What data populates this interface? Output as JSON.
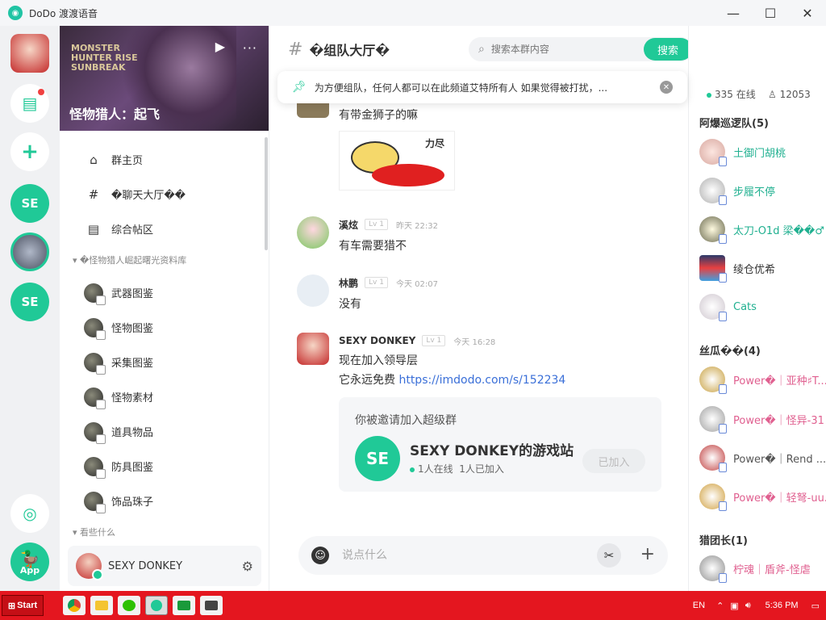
{
  "window": {
    "title": "DoDo 渡渡语音"
  },
  "rail": {
    "se1": "SE",
    "se2": "SE",
    "app_label": "App"
  },
  "guild": {
    "name": "怪物猎人：起飞",
    "banner_text": "MONSTER HUNTER RISE SUNBREAK"
  },
  "channels": [
    {
      "label": "群主页",
      "icon": "home-icon"
    },
    {
      "label": "�聊天大厅��",
      "icon": "hash-icon"
    },
    {
      "label": "综合帖区",
      "icon": "post-icon"
    }
  ],
  "category1": "�怪物猎人崛起曙光资料库",
  "subchannels": [
    {
      "label": "武器图鉴"
    },
    {
      "label": "怪物图鉴"
    },
    {
      "label": "采集图鉴"
    },
    {
      "label": "怪物素材"
    },
    {
      "label": "道具物品"
    },
    {
      "label": "防具图鉴"
    },
    {
      "label": "饰品珠子"
    }
  ],
  "category2": "看些什么",
  "user": {
    "name": "SEXY DONKEY"
  },
  "header": {
    "channel": "�组队大厅�",
    "search_placeholder": "搜索本群内容",
    "search_button": "搜索"
  },
  "notice": {
    "text": "为方便组队，任何人都可以在此频道艾特所有人 如果觉得被打扰，..."
  },
  "messages": [
    {
      "text": "有带金狮子的嘛",
      "sticker": "力尽"
    },
    {
      "name": "溪炫",
      "level": "Lv 1",
      "time": "昨天 22:32",
      "text": "有车需要猎不"
    },
    {
      "name": "林鹏",
      "level": "Lv 1",
      "time": "今天 02:07",
      "text": "没有"
    },
    {
      "name": "SEXY DONKEY",
      "level": "Lv 1",
      "time": "今天 16:28",
      "text1": "现在加入领导层",
      "text2": "它永远免费 ",
      "link": "https://imdodo.com/s/152234"
    }
  ],
  "invite": {
    "title": "你被邀请加入超级群",
    "avatar": "SE",
    "group": "SEXY DONKEY的游戏站",
    "online": "1人在线",
    "joined_count": "1人已加入",
    "button": "已加入"
  },
  "input": {
    "placeholder": "说点什么"
  },
  "members_panel": {
    "online": "335 在线",
    "total": "12053",
    "groups": [
      {
        "name": "阿爆巡逻队(5)"
      },
      {
        "name": "丝瓜��(4)"
      },
      {
        "name": "猎团长(1)"
      }
    ],
    "members": [
      {
        "name": "土御门胡桃",
        "color": "#20b090"
      },
      {
        "name": "步履不停",
        "color": "#20b090"
      },
      {
        "name": "太刀-O1d 梁��♂",
        "color": "#20b090"
      },
      {
        "name": "绫仓优希",
        "color": "#333333"
      },
      {
        "name": "Cats",
        "color": "#20b090"
      },
      {
        "name": "Power�｜亚种♯T...",
        "color": "#e06090"
      },
      {
        "name": "Power�｜怪异-31",
        "color": "#e06090"
      },
      {
        "name": "Power�｜Rend ...",
        "color": "#555555"
      },
      {
        "name": "Power�｜轻弩-uu...",
        "color": "#e06090"
      },
      {
        "name": "柠魂｜盾斧-怪虐",
        "color": "#e06090"
      }
    ]
  },
  "taskbar": {
    "start": "Start",
    "lang": "EN",
    "time": "5:36 PM"
  },
  "colors": {
    "accent": "#20c997",
    "taskbar": "#e4161f"
  }
}
